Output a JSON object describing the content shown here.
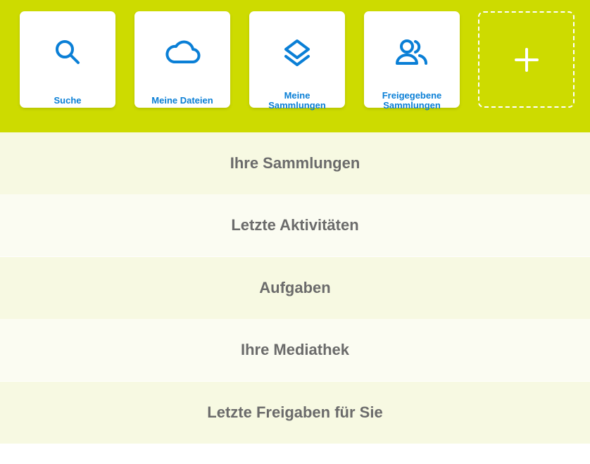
{
  "toolbar": {
    "tiles": [
      {
        "label": "Suche",
        "icon": "search-icon"
      },
      {
        "label": "Meine Dateien",
        "icon": "cloud-icon"
      },
      {
        "label_line1": "Meine",
        "label_line2": "Sammlungen",
        "icon": "layers-icon"
      },
      {
        "label_line1": "Freigegebene",
        "label_line2": "Sammlungen",
        "icon": "users-icon"
      }
    ],
    "add_tile": {
      "symbol": "+",
      "icon": "plus-icon"
    }
  },
  "sections": [
    {
      "title": "Ihre Sammlungen"
    },
    {
      "title": "Letzte Aktivitäten"
    },
    {
      "title": "Aufgaben"
    },
    {
      "title": "Ihre Mediathek"
    },
    {
      "title": "Letzte Freigaben für Sie"
    }
  ],
  "colors": {
    "topbar_bg": "#cddb00",
    "accent": "#0a7fd6",
    "section_text": "#6b6b6b",
    "section_odd_bg": "#f7f9e2",
    "section_even_bg": "#fbfcf2"
  }
}
